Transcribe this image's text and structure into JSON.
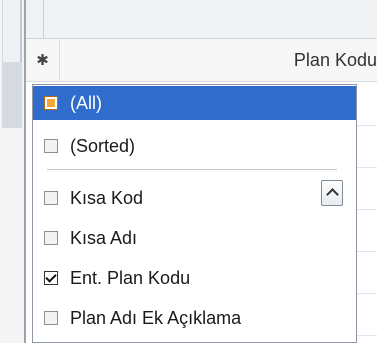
{
  "grid": {
    "corner_symbol": "✱",
    "column_title": "Plan Kodu"
  },
  "filter_popup": {
    "special_items": [
      {
        "label": "(All)",
        "state": "indeterminate",
        "selected": true
      },
      {
        "label": "(Sorted)",
        "state": "unchecked",
        "selected": false
      }
    ],
    "items": [
      {
        "label": "Kısa Kod",
        "state": "unchecked"
      },
      {
        "label": "Kısa Adı",
        "state": "unchecked"
      },
      {
        "label": "Ent. Plan Kodu",
        "state": "checked"
      },
      {
        "label": "Plan Adı Ek Açıklama",
        "state": "unchecked"
      }
    ],
    "scroll_up_icon": "chevron-up-icon"
  },
  "colors": {
    "selection": "#2f6ccc",
    "indeterminate_fill": "#f6a73a"
  }
}
